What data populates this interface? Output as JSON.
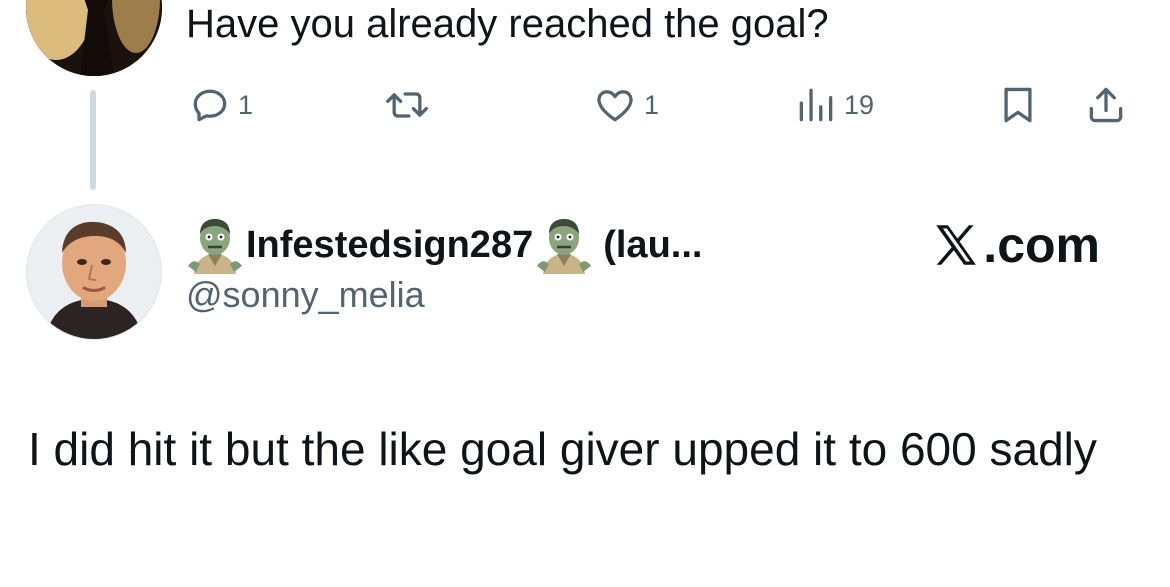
{
  "previous_tweet": {
    "text": "Have you already reached the goal?",
    "actions": {
      "reply_icon": "reply-icon",
      "reply_count": "1",
      "retweet_icon": "retweet-icon",
      "retweet_count": "",
      "like_icon": "heart-icon",
      "like_count": "1",
      "views_icon": "views-chart-icon",
      "views_count": "19",
      "bookmark_icon": "bookmark-icon",
      "share_icon": "share-icon"
    }
  },
  "reply_tweet": {
    "display_name": "Infestedsign287",
    "display_name_suffix": "(lau...",
    "name_emoji": "zombie-emoji",
    "handle": "@sonny_melia",
    "text": "I did hit it but the like goal giver upped it to 600 sadly"
  },
  "brand": {
    "label": ".com",
    "logo": "x-logo-icon"
  },
  "colors": {
    "text_primary": "#0f1419",
    "text_secondary": "#536471",
    "thread_line": "#cfd9de"
  }
}
